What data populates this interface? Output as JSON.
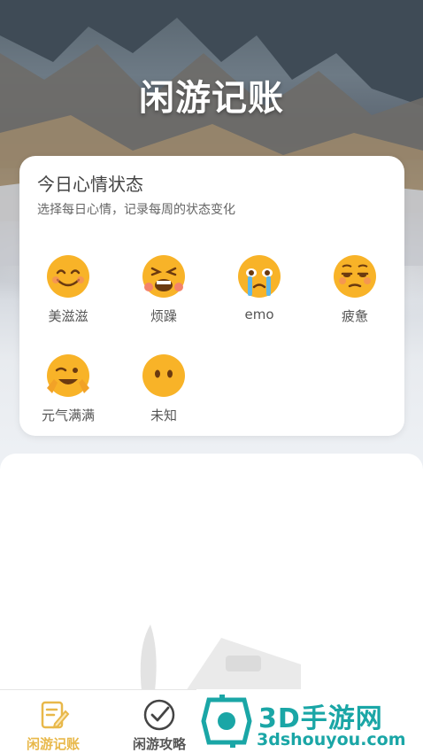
{
  "header": {
    "title": "闲游记账"
  },
  "mood_card": {
    "title": "今日心情状态",
    "subtitle": "选择每日心情，记录每周的状态变化",
    "moods": [
      {
        "label": "美滋滋",
        "icon": "smiling-face-icon"
      },
      {
        "label": "烦躁",
        "icon": "tired-face-icon"
      },
      {
        "label": "emo",
        "icon": "crying-face-icon"
      },
      {
        "label": "疲惫",
        "icon": "weary-face-icon"
      },
      {
        "label": "元气满满",
        "icon": "winking-fingers-face-icon"
      },
      {
        "label": "未知",
        "icon": "blank-face-icon"
      }
    ]
  },
  "tabbar": {
    "tabs": [
      {
        "label": "闲游记账",
        "icon": "note-edit-icon",
        "active": true
      },
      {
        "label": "闲游攻略",
        "icon": "checkmark-circle-icon",
        "active": false
      }
    ]
  },
  "watermark": {
    "name": "3D手游网",
    "url": "3dshouyou.com"
  },
  "colors": {
    "active_tab": "#e8b84a",
    "inactive_tab": "#555555",
    "watermark": "#1aa6a6",
    "emoji": "#f8b328"
  }
}
